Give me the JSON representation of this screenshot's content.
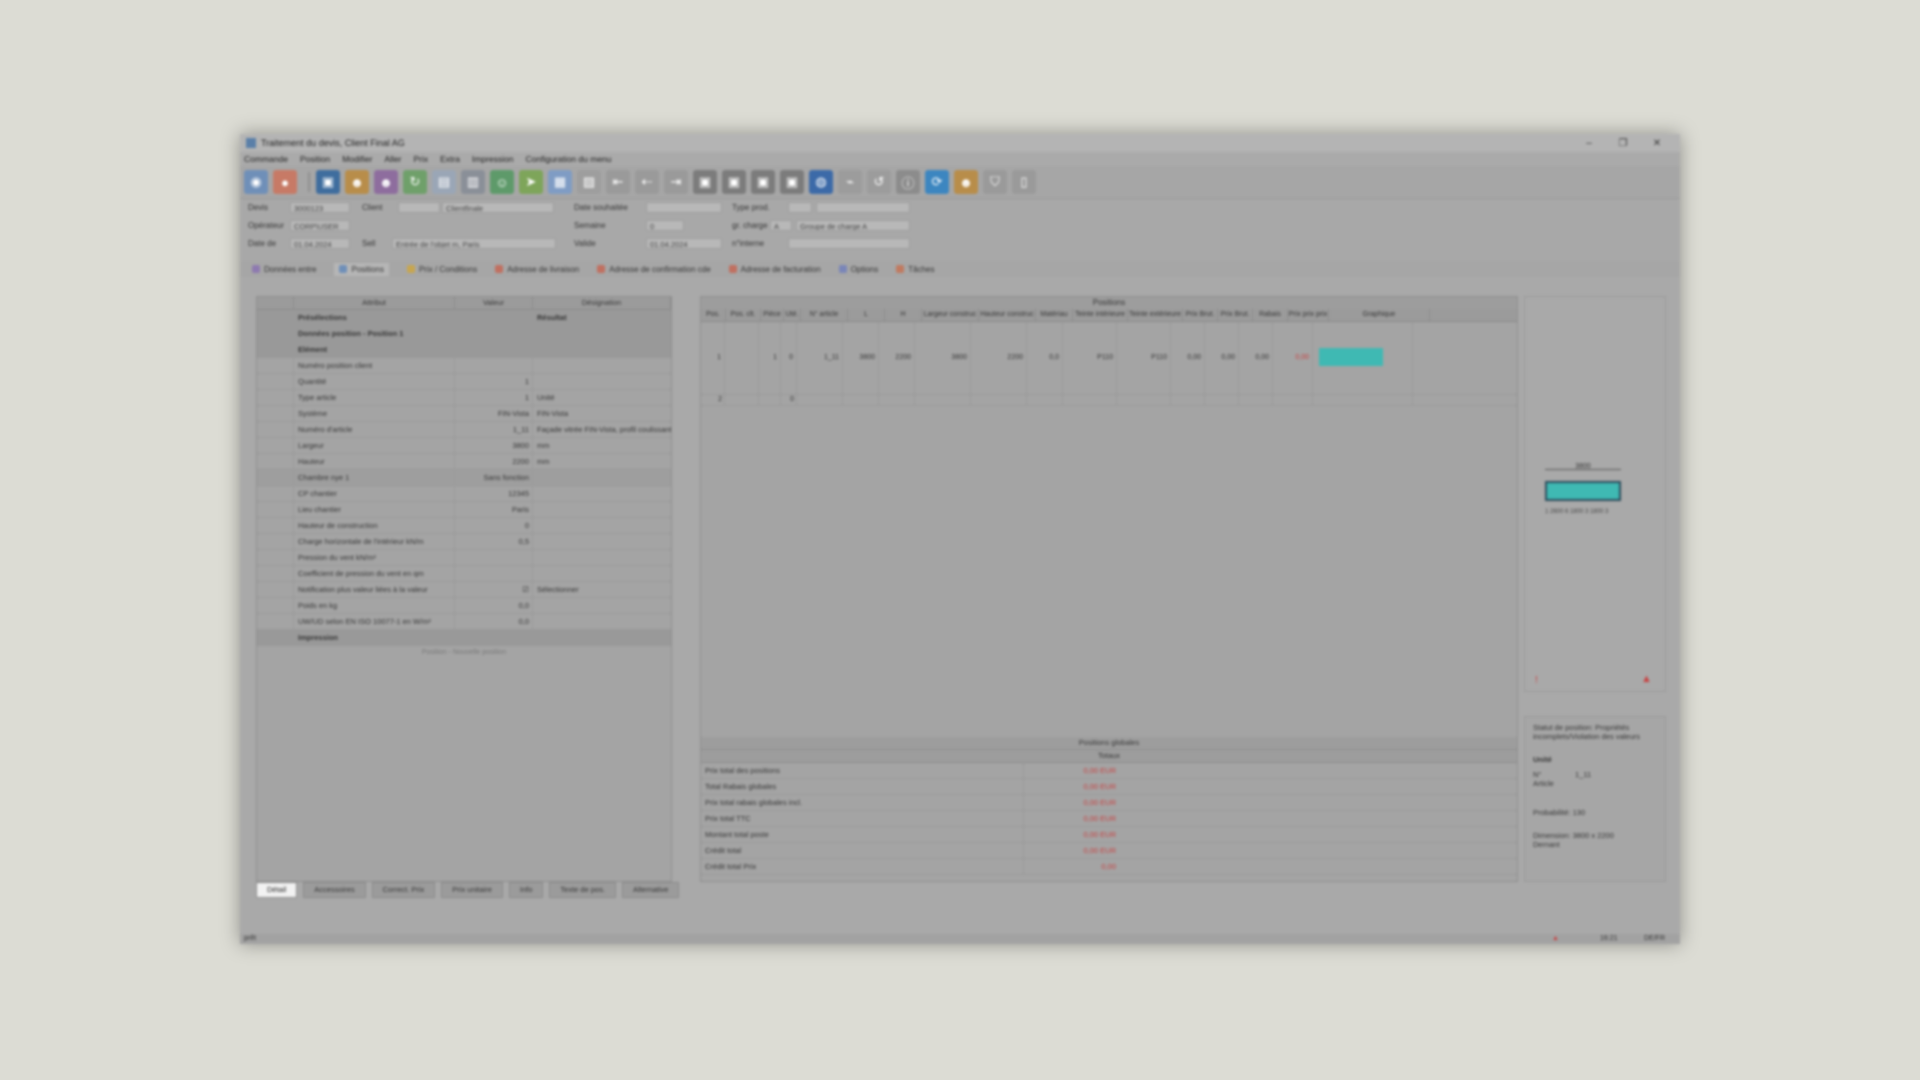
{
  "window": {
    "title": "Traitement du devis, Client Final AG"
  },
  "menu": [
    "Commande",
    "Position",
    "Modifier",
    "Aller",
    "Prix",
    "Extra",
    "Impression",
    "Configuration du menu"
  ],
  "header": {
    "devis_label": "Devis",
    "devis_value": "3000123",
    "client_label": "Client",
    "client_value": "Clientfinale",
    "operateur_label": "Opérateur",
    "operateur_value": "CORP\\USER",
    "date_label": "Date de",
    "date_value": "01.04.2024",
    "sell_label": "Sell",
    "sell_value": "Entrée de l'objet m, Paris",
    "date_souhaitee_label": "Date souhaitée",
    "semaine_label": "Semaine",
    "semaine_value": "0",
    "gr_charge_label": "gr. charge",
    "gr_charge_value": "A",
    "gr_charge_desc": "Groupe de charge A",
    "valide_label": "Valide",
    "valide_value": "01.04.2024",
    "n_interne_label": "n°interne",
    "type_prod_label": "Type prod."
  },
  "tabs": [
    "Données entre",
    "Positions",
    "Prix / Conditions",
    "Adresse de livraison",
    "Adresse de confirmation cde",
    "Adresse de facturation",
    "Options",
    "Tâches"
  ],
  "left": {
    "headers": [
      "Attribut",
      "Valeur",
      "Désignation"
    ],
    "rows": [
      {
        "type": "group",
        "label": "Présélections",
        "value": "",
        "desc": "Résultat"
      },
      {
        "type": "group",
        "label": "Données position - Position 1",
        "value": "",
        "desc": ""
      },
      {
        "type": "group",
        "label": "Elément",
        "value": "",
        "desc": ""
      },
      {
        "label": "Numéro position client",
        "value": "",
        "desc": ""
      },
      {
        "label": "Quantité",
        "value": "1",
        "desc": ""
      },
      {
        "label": "Type article",
        "value": "1",
        "desc": "Unité"
      },
      {
        "label": "Système",
        "value": "FIN-Vista",
        "desc": "FIN-Vista"
      },
      {
        "label": "Numéro d'article",
        "value": "1_11",
        "desc": "Façade vitrée FIN-Vista, profil coulissant"
      },
      {
        "label": "Largeur",
        "value": "3800",
        "desc": "mm"
      },
      {
        "label": "Hauteur",
        "value": "2200",
        "desc": "mm"
      },
      {
        "type": "sel",
        "label": "Chambre nye 1",
        "value": "Sans fonction",
        "desc": ""
      },
      {
        "label": "CP chantier",
        "value": "12345",
        "desc": ""
      },
      {
        "label": "Lieu chantier",
        "value": "Paris",
        "desc": ""
      },
      {
        "label": "Hauteur de construction",
        "value": "0",
        "desc": ""
      },
      {
        "label": "Charge horizontale de l'intérieur kN/m",
        "value": "0,5",
        "desc": ""
      },
      {
        "label": "Pression du vent kN/m²",
        "value": "",
        "desc": ""
      },
      {
        "label": "Coefficient de pression du vent en qm",
        "value": "",
        "desc": ""
      },
      {
        "label": "Notification plus valeur liées à la valeur",
        "value": "☑",
        "desc": "Sélectionner"
      },
      {
        "label": "Poids en kg",
        "value": "0,0",
        "desc": ""
      },
      {
        "label": "UW/UD selon EN ISO 10077-1 en W/m²",
        "value": "0,0",
        "desc": ""
      },
      {
        "type": "group",
        "label": "Impression",
        "value": "",
        "desc": ""
      }
    ],
    "footer": "Position - Nouvelle position"
  },
  "center": {
    "title": "Positions",
    "headers": [
      "Pos.",
      "Pos. clt.",
      "Pièce",
      "Uté.",
      "N° article",
      "L",
      "H",
      "Largeur construc",
      "Hauteur construc",
      "Matériau",
      "Teinte intérieure",
      "Teinte extérieure",
      "Prix Brut.",
      "Prix Brut.",
      "Rabais",
      "Prix prix prix",
      "Graphique"
    ],
    "row1": [
      "1",
      "",
      "1",
      "0",
      "1_11",
      "3800",
      "2200",
      "3800",
      "2200",
      "0,0",
      "P110",
      "P110",
      "0,00",
      "0,00",
      "0,00",
      "0,00",
      ""
    ],
    "row2": [
      "2",
      "",
      "",
      "0",
      "",
      "",
      "",
      "",
      "",
      "",
      "",
      "",
      "",
      "",
      "",
      "",
      ""
    ],
    "totals_title": "Positions globales",
    "totals_sub": "Totaux",
    "totals": [
      {
        "k": "Prix total des positions",
        "v": "0,00 EUR"
      },
      {
        "k": "Total Rabais globales",
        "v": "0,00 EUR"
      },
      {
        "k": "Prix total rabais globales incl.",
        "v": "0,00 EUR"
      },
      {
        "k": "Prix total TTC",
        "v": "0,00 EUR"
      },
      {
        "k": "Montant total poste",
        "v": "0,00 EUR"
      },
      {
        "k": "Crédit total",
        "v": "0,00 EUR"
      },
      {
        "k": "Crédit total Prix",
        "v": "0,00"
      }
    ]
  },
  "right": {
    "dim_top": "3800",
    "dim_bottom": "1 2600 6 1800 3 1800 3",
    "info_title": "Statut de position: Propriétés incomplets/Violation des valeurs",
    "info_unit": "Unité",
    "info_no": "N°",
    "info_article": "Article",
    "info_article_val": "1_11",
    "info_prob": "Probabilité: 130",
    "info_dim": "Dimension: 3800 x 2200",
    "info_dim2": "Dernant"
  },
  "bottom_tabs": [
    "Détail",
    "Accessoires",
    "Correct. Prix",
    "Prix unitaire",
    "Info",
    "Texte de pos.",
    "Alternative"
  ],
  "status": {
    "left": "prêt",
    "center": "16:21",
    "right": "DE/FR"
  },
  "colors": {
    "accent_teal": "#3fb9b3",
    "warn": "#c84040"
  }
}
